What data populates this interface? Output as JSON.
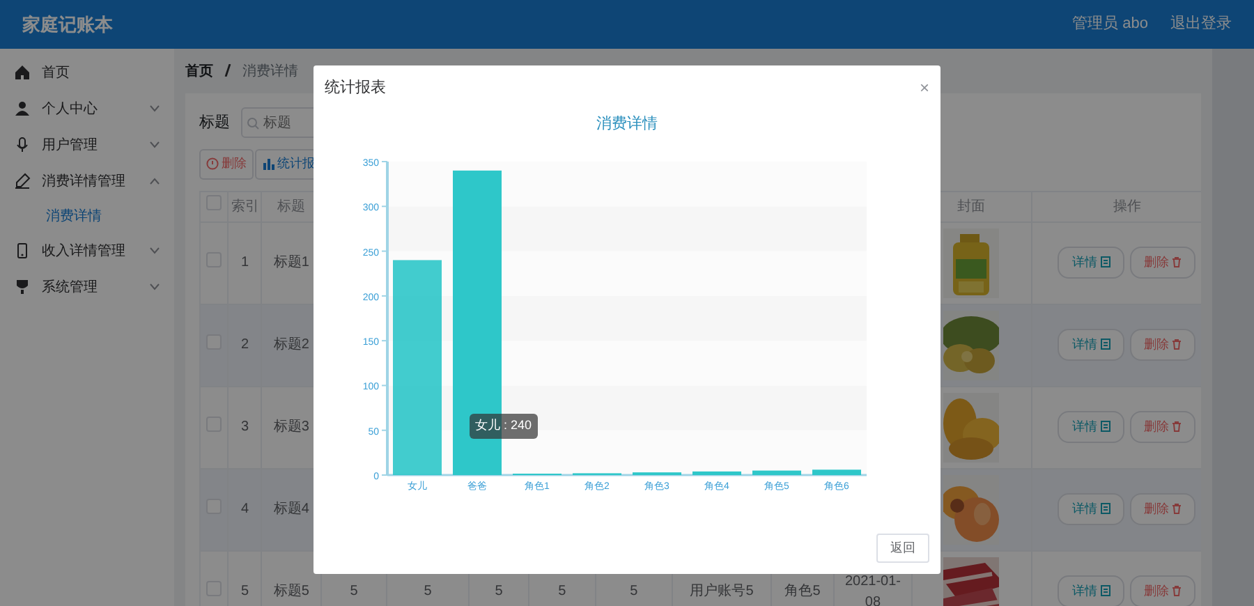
{
  "navbar": {
    "brand": "家庭记账本",
    "user": "管理员 abo",
    "logout": "退出登录"
  },
  "sidebar": {
    "items": [
      {
        "label": "首页"
      },
      {
        "label": "个人中心",
        "expanded": false
      },
      {
        "label": "用户管理",
        "expanded": false
      },
      {
        "label": "消费详情管理",
        "expanded": true,
        "children": [
          {
            "label": "消费详情",
            "selected": true
          }
        ]
      },
      {
        "label": "收入详情管理",
        "expanded": false
      },
      {
        "label": "系统管理",
        "expanded": false
      }
    ]
  },
  "breadcrumb": [
    "首页",
    "消费详情"
  ],
  "filter": {
    "label": "标题",
    "placeholder": "标题"
  },
  "actions": [
    {
      "label": "删除",
      "kind": "danger"
    },
    {
      "label": "统计报",
      "kind": "chart"
    }
  ],
  "table": {
    "header": {
      "checked": false,
      "index": "索引",
      "title": "标题",
      "cover": "封面",
      "operations": "操作"
    },
    "rows": [
      {
        "checked": false,
        "index": "1",
        "title": "标题1",
        "cells": [],
        "picture": {
          "kind": "picture"
        },
        "buttons": [
          {
            "label": "详情",
            "kind": "detail"
          },
          {
            "label": "删除",
            "kind": "danger"
          }
        ]
      },
      {
        "checked": false,
        "index": "2",
        "title": "标题2",
        "cells": [],
        "picture": {
          "kind": "picture"
        },
        "buttons": [
          {
            "label": "详情",
            "kind": "detail"
          },
          {
            "label": "删除",
            "kind": "danger"
          }
        ]
      },
      {
        "checked": false,
        "index": "3",
        "title": "标题3",
        "cells": [],
        "picture": {
          "kind": "picture"
        },
        "buttons": [
          {
            "label": "详情",
            "kind": "detail"
          },
          {
            "label": "删除",
            "kind": "danger"
          }
        ]
      },
      {
        "checked": false,
        "index": "4",
        "title": "标题4",
        "cells": [],
        "picture": {
          "kind": "picture"
        },
        "buttons": [
          {
            "label": "详情",
            "kind": "detail"
          },
          {
            "label": "删除",
            "kind": "danger"
          }
        ]
      },
      {
        "checked": false,
        "index": "5",
        "title": "标题5",
        "cells": [
          "5",
          "5",
          "5",
          "5",
          "5",
          "用户账号5",
          "角色5",
          "2021-01-08"
        ],
        "picture": {
          "kind": "picture"
        },
        "buttons": [
          {
            "label": "详情",
            "kind": "detail"
          },
          {
            "label": "删除",
            "kind": "danger"
          }
        ]
      }
    ]
  },
  "modal": {
    "title": "统计报表",
    "close": "×",
    "tooltip": "女儿 : 240",
    "footer_button": "返回",
    "chart_data": {
      "type": "bar",
      "title": "消费详情",
      "categories": [
        "女儿",
        "爸爸",
        "角色1",
        "角色2",
        "角色3",
        "角色4",
        "角色5",
        "角色6"
      ],
      "series": [
        {
          "color": "#2ec7c9",
          "values": [
            240,
            340,
            1,
            2,
            3,
            4,
            5,
            6
          ]
        }
      ],
      "ylim": [
        0,
        350
      ],
      "yticks": [
        0,
        50,
        100,
        150,
        200,
        250,
        300,
        350
      ]
    }
  }
}
